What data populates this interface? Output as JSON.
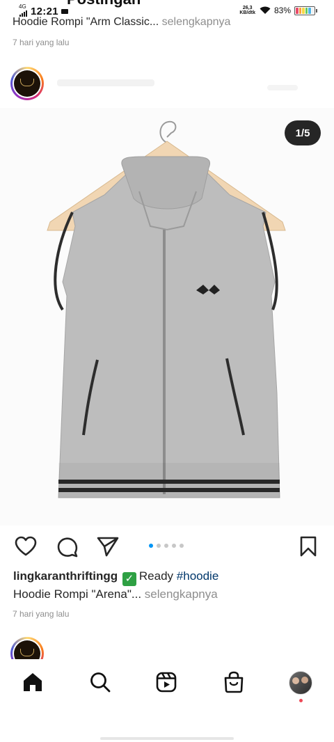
{
  "status_bar": {
    "network": "4G",
    "time": "12:21",
    "speed_value": "26,3",
    "speed_unit": "KB/dtk",
    "battery": "83%"
  },
  "header": {
    "title": "Postingan",
    "back_icon": "arrow-left-icon"
  },
  "previous_post": {
    "caption_text": "Hoodie Rompi \"Arm Classic...",
    "more_label": "selengkapnya",
    "time": "7 hari yang lalu"
  },
  "post": {
    "image_counter": "1/5",
    "image_count": 5,
    "current_image": 1,
    "username": "lingkaranthriftingg",
    "badge_icon": "check-mark-button-icon",
    "caption_word": "Ready",
    "hashtag": "#hoodie",
    "caption_line2": "Hoodie Rompi \"Arena\"...",
    "more_label": "selengkapnya",
    "time": "7 hari yang lalu"
  },
  "actions": {
    "like_icon": "heart-icon",
    "comment_icon": "comment-icon",
    "share_icon": "paper-plane-icon",
    "save_icon": "bookmark-icon"
  },
  "bottom_nav": {
    "items": [
      "home-icon",
      "search-icon",
      "reels-icon",
      "shop-icon",
      "profile-avatar"
    ]
  },
  "colors": {
    "link_blue": "#00376b",
    "active_dot": "#0095f6",
    "notification": "#ed4956"
  }
}
